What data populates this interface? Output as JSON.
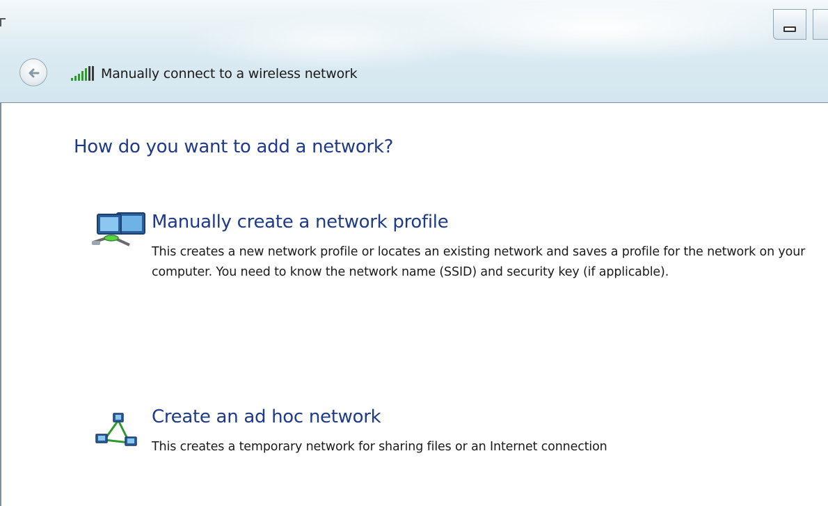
{
  "window": {
    "title": "Manually connect to a wireless network"
  },
  "icons": {
    "back": "back-arrow-icon",
    "signal": "wireless-signal-icon",
    "manual_profile": "network-computers-icon",
    "adhoc": "adhoc-network-icon",
    "minimize": "minimize-icon"
  },
  "main": {
    "heading": "How do you want to add a network?",
    "options": [
      {
        "title": "Manually create a network profile",
        "description": "This creates a new network profile or locates an existing network and saves a profile for the network on your computer. You need to know the network name (SSID) and security key (if applicable)."
      },
      {
        "title": "Create an ad hoc network",
        "description": "This creates a temporary network for sharing files or an Internet connection"
      }
    ]
  },
  "colors": {
    "heading_blue": "#1e3a8a",
    "signal_green": "#2e9a2a",
    "border": "#7d8f9c"
  }
}
